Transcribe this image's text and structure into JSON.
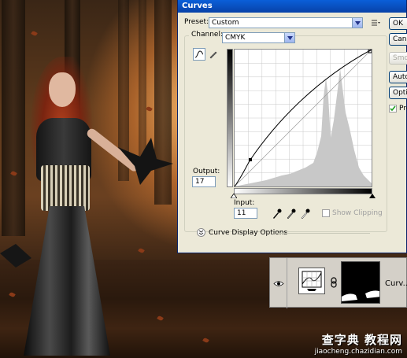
{
  "dialog": {
    "title": "Curves",
    "preset_label": "Preset:",
    "preset_value": "Custom",
    "channel_label": "Channel:",
    "channel_value": "CMYK",
    "output_label": "Output:",
    "output_value": "17",
    "input_label": "Input:",
    "input_value": "11",
    "show_clipping_label": "Show Clipping",
    "show_clipping_checked": false,
    "curve_display_options_label": "Curve Display Options",
    "buttons": [
      {
        "label": "OK",
        "enabled": true
      },
      {
        "label": "Cancel",
        "enabled": true
      },
      {
        "label": "Smooth",
        "enabled": false
      },
      {
        "label": "Auto",
        "enabled": true
      },
      {
        "label": "Options...",
        "enabled": true
      }
    ],
    "preview_label": "Preview",
    "preview_checked": true
  },
  "layers": {
    "layer_name": "Curv..."
  },
  "watermark": {
    "title": "查字典 教程网",
    "url": "jiaocheng.chazidian.com"
  },
  "colors": {
    "titlebar": "#0842a8",
    "dialog_bg": "#ece9d8"
  }
}
